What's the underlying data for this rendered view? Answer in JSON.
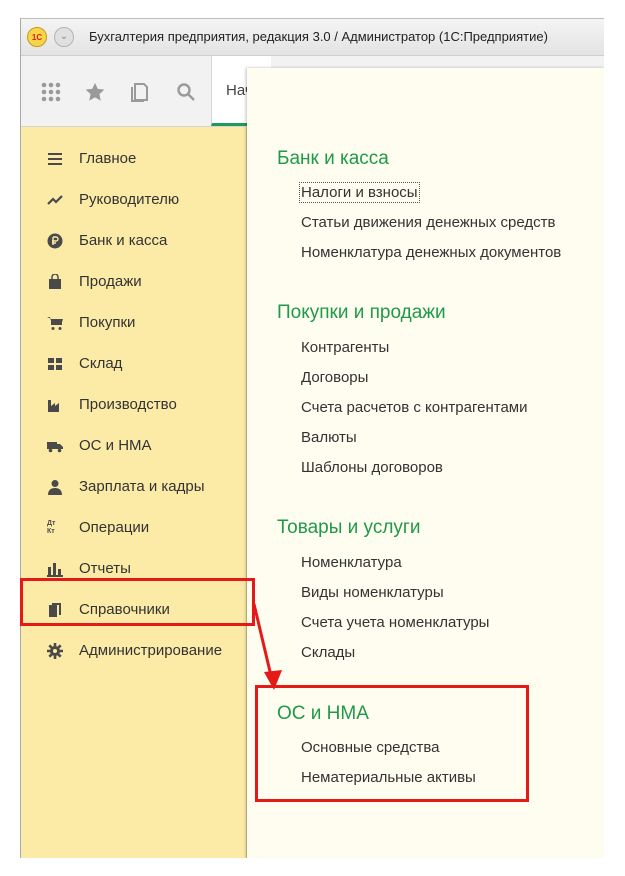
{
  "window": {
    "logo_text": "1С",
    "title": "Бухгалтерия предприятия, редакция 3.0 / Администратор  (1С:Предприятие)"
  },
  "toolbar": {
    "icons": [
      "apps-grid-icon",
      "star-icon",
      "history-icon",
      "search-icon"
    ],
    "home_tab_label": "Нач"
  },
  "sidebar": {
    "items": [
      {
        "label": "Главное",
        "icon": "menu-lines-icon"
      },
      {
        "label": "Руководителю",
        "icon": "trend-icon"
      },
      {
        "label": "Банк и касса",
        "icon": "ruble-coin-icon"
      },
      {
        "label": "Продажи",
        "icon": "shopping-bag-icon"
      },
      {
        "label": "Покупки",
        "icon": "cart-icon"
      },
      {
        "label": "Склад",
        "icon": "warehouse-icon"
      },
      {
        "label": "Производство",
        "icon": "factory-icon"
      },
      {
        "label": "ОС и НМА",
        "icon": "truck-icon"
      },
      {
        "label": "Зарплата и кадры",
        "icon": "person-icon"
      },
      {
        "label": "Операции",
        "icon": "debit-credit-icon",
        "icon_text": "Дт Кт"
      },
      {
        "label": "Отчеты",
        "icon": "bar-chart-icon"
      },
      {
        "label": "Справочники",
        "icon": "books-icon"
      },
      {
        "label": "Администрирование",
        "icon": "gear-icon"
      }
    ]
  },
  "panel": {
    "sections": [
      {
        "title": "Банк и касса",
        "links": [
          "Налоги и взносы",
          "Статьи движения денежных средств",
          "Номенклатура денежных документов"
        ]
      },
      {
        "title": "Покупки и продажи",
        "links": [
          "Контрагенты",
          "Договоры",
          "Счета расчетов с контрагентами",
          "Валюты",
          "Шаблоны договоров"
        ]
      },
      {
        "title": "Товары и услуги",
        "links": [
          "Номенклатура",
          "Виды номенклатуры",
          "Счета учета номенклатуры",
          "Склады"
        ]
      },
      {
        "title": "ОС и НМА",
        "links": [
          "Основные средства",
          "Нематериальные активы"
        ]
      }
    ]
  },
  "annotation": {
    "color": "#e61919"
  }
}
